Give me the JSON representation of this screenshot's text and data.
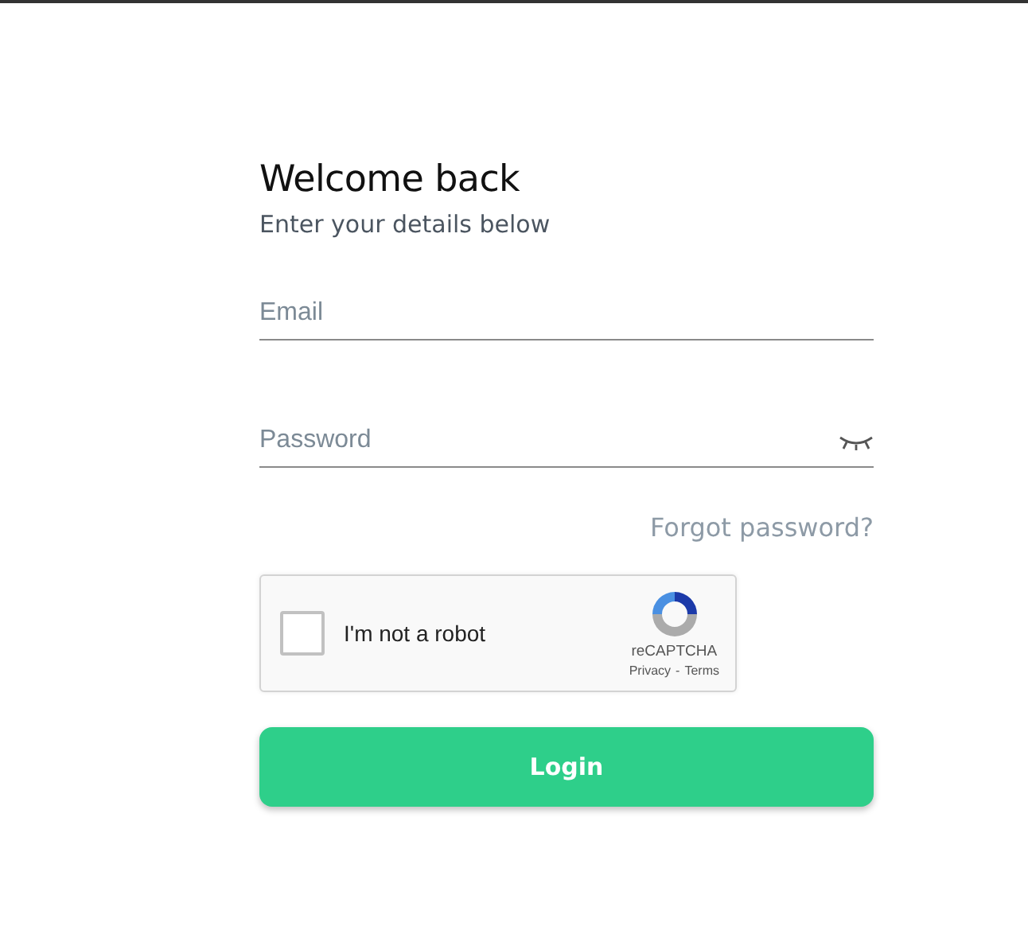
{
  "heading": {
    "title": "Welcome back",
    "subtitle": "Enter your details below"
  },
  "fields": [
    {
      "kind": "text",
      "placeholder": "Email"
    },
    {
      "kind": "password",
      "placeholder": "Password"
    }
  ],
  "forgot_link": "Forgot password?",
  "captcha": {
    "label": "I'm not a robot",
    "checked": false,
    "brand": "reCAPTCHA",
    "links": [
      "Privacy",
      "Terms"
    ],
    "separator": "-"
  },
  "login_button": "Login"
}
